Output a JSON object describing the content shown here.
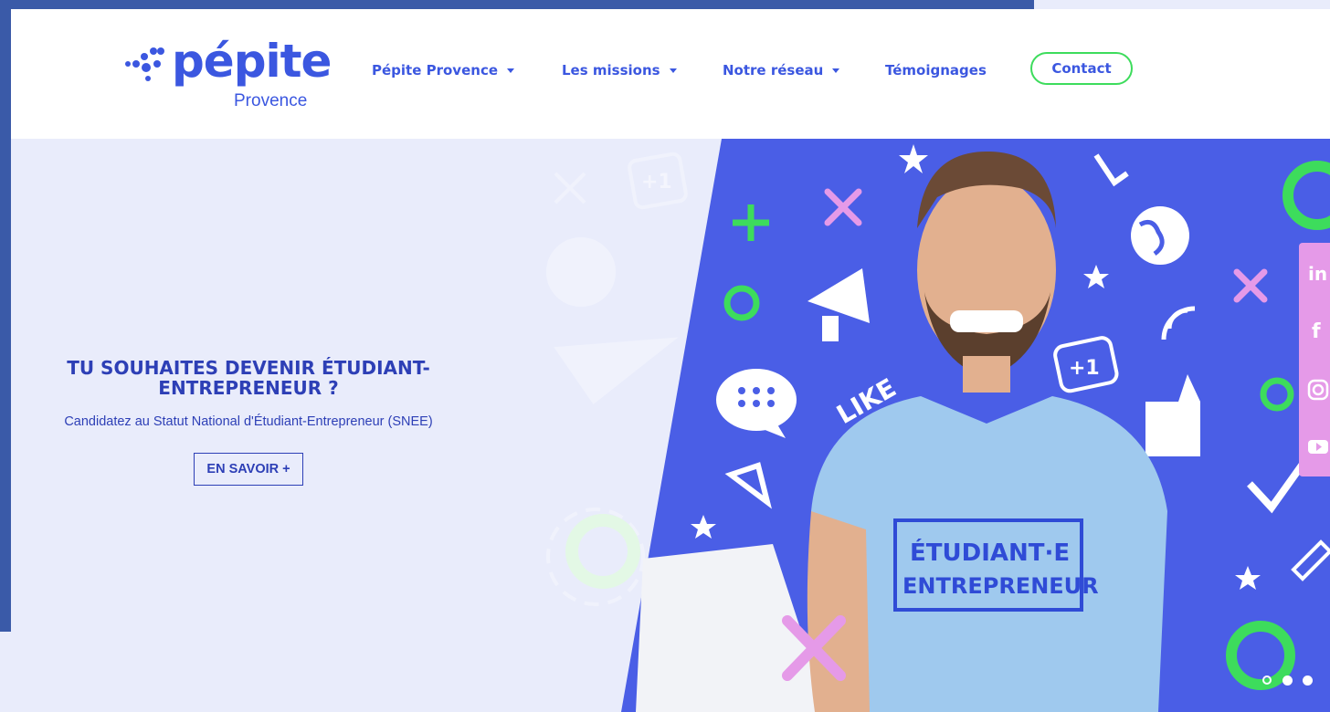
{
  "brand": {
    "logo_word": "pépite",
    "logo_sub": "Provence",
    "primary_color": "#3b57e0",
    "accent_green": "#3ddc5c",
    "hero_blue": "#4a5ee6"
  },
  "nav": {
    "items": [
      {
        "label": "Pépite Provence",
        "has_dropdown": true
      },
      {
        "label": "Les missions",
        "has_dropdown": true
      },
      {
        "label": "Notre réseau",
        "has_dropdown": true
      },
      {
        "label": "Témoignages",
        "has_dropdown": false
      }
    ],
    "contact_label": "Contact"
  },
  "hero": {
    "title_line1": "TU SOUHAITES DEVENIR ÉTUDIANT-",
    "title_line2": "ENTREPRENEUR ?",
    "subtitle": "Candidatez au Statut National d'Étudiant-Entrepreneur (SNEE)",
    "cta_label": "EN SAVOIR +",
    "tshirt_line1": "ÉTUDIANT·E",
    "tshirt_line2": "ENTREPRENEUR",
    "doodle_like": "LIKE",
    "doodle_plus_one": "+1"
  },
  "social": {
    "icons": [
      "linkedin-icon",
      "facebook-icon",
      "instagram-icon",
      "youtube-icon"
    ],
    "labels": [
      "in",
      "f"
    ]
  },
  "carousel": {
    "slide_count": 3,
    "active_index": 1
  }
}
